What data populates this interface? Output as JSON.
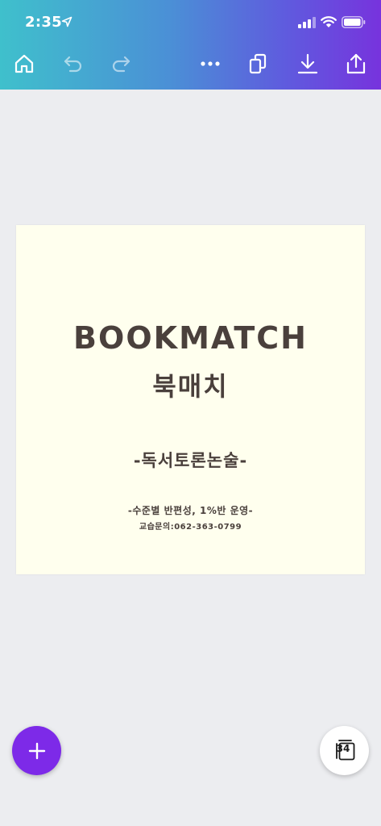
{
  "status_bar": {
    "time": "2:35",
    "icons": [
      "location-arrow-icon",
      "cellular-signal-icon",
      "wifi-icon",
      "battery-icon"
    ]
  },
  "toolbar": {
    "icons": [
      "home-icon",
      "undo-icon",
      "redo-icon",
      "more-icon",
      "duplicate-icon",
      "download-icon",
      "share-icon"
    ]
  },
  "design": {
    "background_color": "#FFFFEE",
    "text_color": "#4A403C",
    "title_en": "BOOKMATCH",
    "title_ko": "북매치",
    "subtitle": "-독서토론논술-",
    "info_line": "-수준별 반편성, 1%반 운영-",
    "contact_line": "교습문의:062-363-0799"
  },
  "fab": {
    "add_icon": "plus-icon",
    "add_color": "#7D2AE8"
  },
  "pages_button": {
    "count": "34",
    "icon": "pages-stack-icon"
  },
  "colors": {
    "header_gradient": [
      "#3FC0CC",
      "#4B8FD6",
      "#5F5BDE",
      "#7733DD"
    ],
    "workspace": "#ECEDF0"
  }
}
